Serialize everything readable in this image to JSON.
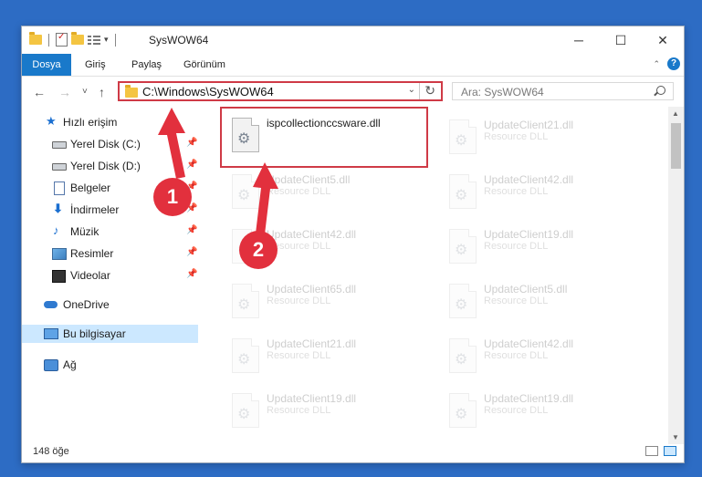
{
  "window": {
    "title": "SysWOW64",
    "controls": {
      "minimize": "─",
      "maximize": "☐",
      "close": "✕"
    }
  },
  "ribbon": {
    "tabs": [
      {
        "label": "Dosya",
        "active": true
      },
      {
        "label": "Giriş"
      },
      {
        "label": "Paylaş"
      },
      {
        "label": "Görünüm"
      }
    ],
    "help": "?"
  },
  "navigation": {
    "back": "←",
    "forward": "→",
    "recent": "˅",
    "up": "↑",
    "address": "C:\\Windows\\SysWOW64",
    "search_placeholder": "Ara: SysWOW64"
  },
  "sidebar": {
    "items": [
      {
        "label": "Hızlı erişim",
        "icon": "star-icon",
        "pinned": false
      },
      {
        "label": "Yerel Disk (C:)",
        "icon": "drive-icon",
        "pinned": true
      },
      {
        "label": "Yerel Disk (D:)",
        "icon": "drive-icon",
        "pinned": true
      },
      {
        "label": "Belgeler",
        "icon": "documents-icon",
        "pinned": true
      },
      {
        "label": "İndirmeler",
        "icon": "download-icon",
        "pinned": true
      },
      {
        "label": "Müzik",
        "icon": "music-icon",
        "pinned": true
      },
      {
        "label": "Resimler",
        "icon": "pictures-icon",
        "pinned": true
      },
      {
        "label": "Videolar",
        "icon": "video-icon",
        "pinned": true
      },
      {
        "label": "OneDrive",
        "icon": "cloud-icon",
        "pinned": false
      },
      {
        "label": "Bu bilgisayar",
        "icon": "computer-icon",
        "pinned": false,
        "selected": true
      },
      {
        "label": "Ağ",
        "icon": "network-icon",
        "pinned": false
      }
    ]
  },
  "files": [
    {
      "name": "ispcollectionccsware.dll",
      "type": "",
      "highlighted": true
    },
    {
      "name": "UpdateClient21.dll",
      "type": "Resource DLL"
    },
    {
      "name": "UpdateClient5.dll",
      "type": "Resource DLL"
    },
    {
      "name": "UpdateClient42.dll",
      "type": "Resource DLL"
    },
    {
      "name": "UpdateClient42.dll",
      "type": "Resource DLL"
    },
    {
      "name": "UpdateClient19.dll",
      "type": "Resource DLL"
    },
    {
      "name": "UpdateClient65.dll",
      "type": "Resource DLL"
    },
    {
      "name": "UpdateClient5.dll",
      "type": "Resource DLL"
    },
    {
      "name": "UpdateClient21.dll",
      "type": "Resource DLL"
    },
    {
      "name": "UpdateClient42.dll",
      "type": "Resource DLL"
    },
    {
      "name": "UpdateClient19.dll",
      "type": "Resource DLL"
    },
    {
      "name": "UpdateClient19.dll",
      "type": "Resource DLL"
    }
  ],
  "status": {
    "count": "148 öğe"
  },
  "callouts": [
    "1",
    "2"
  ],
  "colors": {
    "accent": "#1979ca",
    "highlight": "#cf3a46",
    "callout": "#e2303d",
    "selected": "#cce8ff"
  }
}
